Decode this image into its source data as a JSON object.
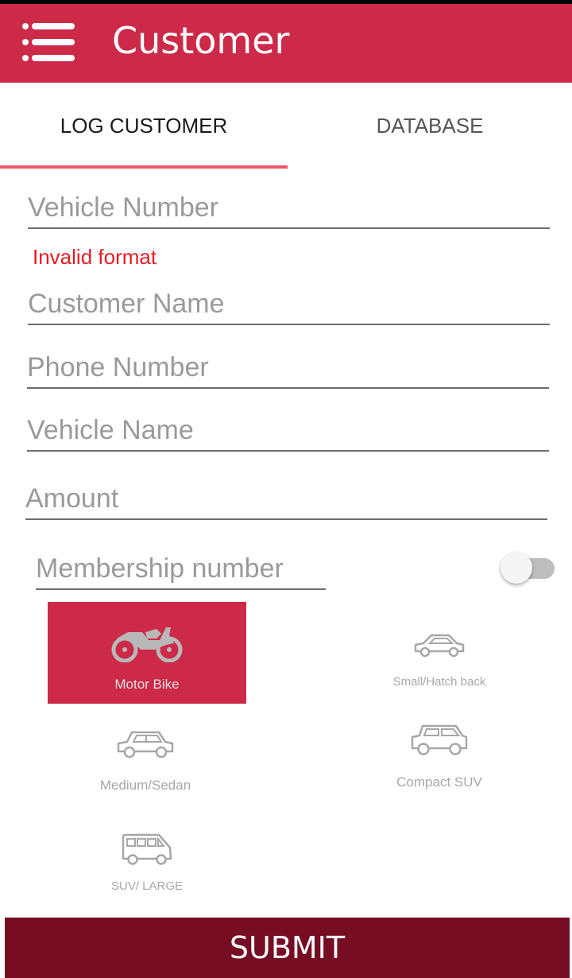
{
  "header": {
    "title": "Customer",
    "menu_icon": "hamburger-menu-icon"
  },
  "tabs": [
    {
      "label": "LOG CUSTOMER",
      "active": true
    },
    {
      "label": "DATABASE",
      "active": false
    }
  ],
  "form": {
    "vehicle_number": {
      "placeholder": "Vehicle Number",
      "value": ""
    },
    "vehicle_number_error": "Invalid format",
    "customer_name": {
      "placeholder": "Customer Name",
      "value": ""
    },
    "phone_number": {
      "placeholder": "Phone Number",
      "value": ""
    },
    "vehicle_name": {
      "placeholder": "Vehicle Name",
      "value": ""
    },
    "amount": {
      "placeholder": "Amount",
      "value": ""
    },
    "membership_number": {
      "placeholder": "Membership number",
      "value": ""
    },
    "membership_toggle_on": false
  },
  "vehicle_types": [
    {
      "label": "Motor Bike",
      "icon": "motorbike-icon",
      "selected": true
    },
    {
      "label": "Small/Hatch back",
      "icon": "hatchback-car-icon",
      "selected": false
    },
    {
      "label": "Medium/Sedan",
      "icon": "sedan-car-icon",
      "selected": false
    },
    {
      "label": "Compact SUV",
      "icon": "compact-suv-icon",
      "selected": false
    },
    {
      "label": "SUV/ LARGE",
      "icon": "large-suv-van-icon",
      "selected": false
    }
  ],
  "submit_label": "SUBMIT",
  "colors": {
    "primary": "#cc2a48",
    "tab_indicator": "#f0576a",
    "submit": "#760d23",
    "error": "#e51c23"
  }
}
